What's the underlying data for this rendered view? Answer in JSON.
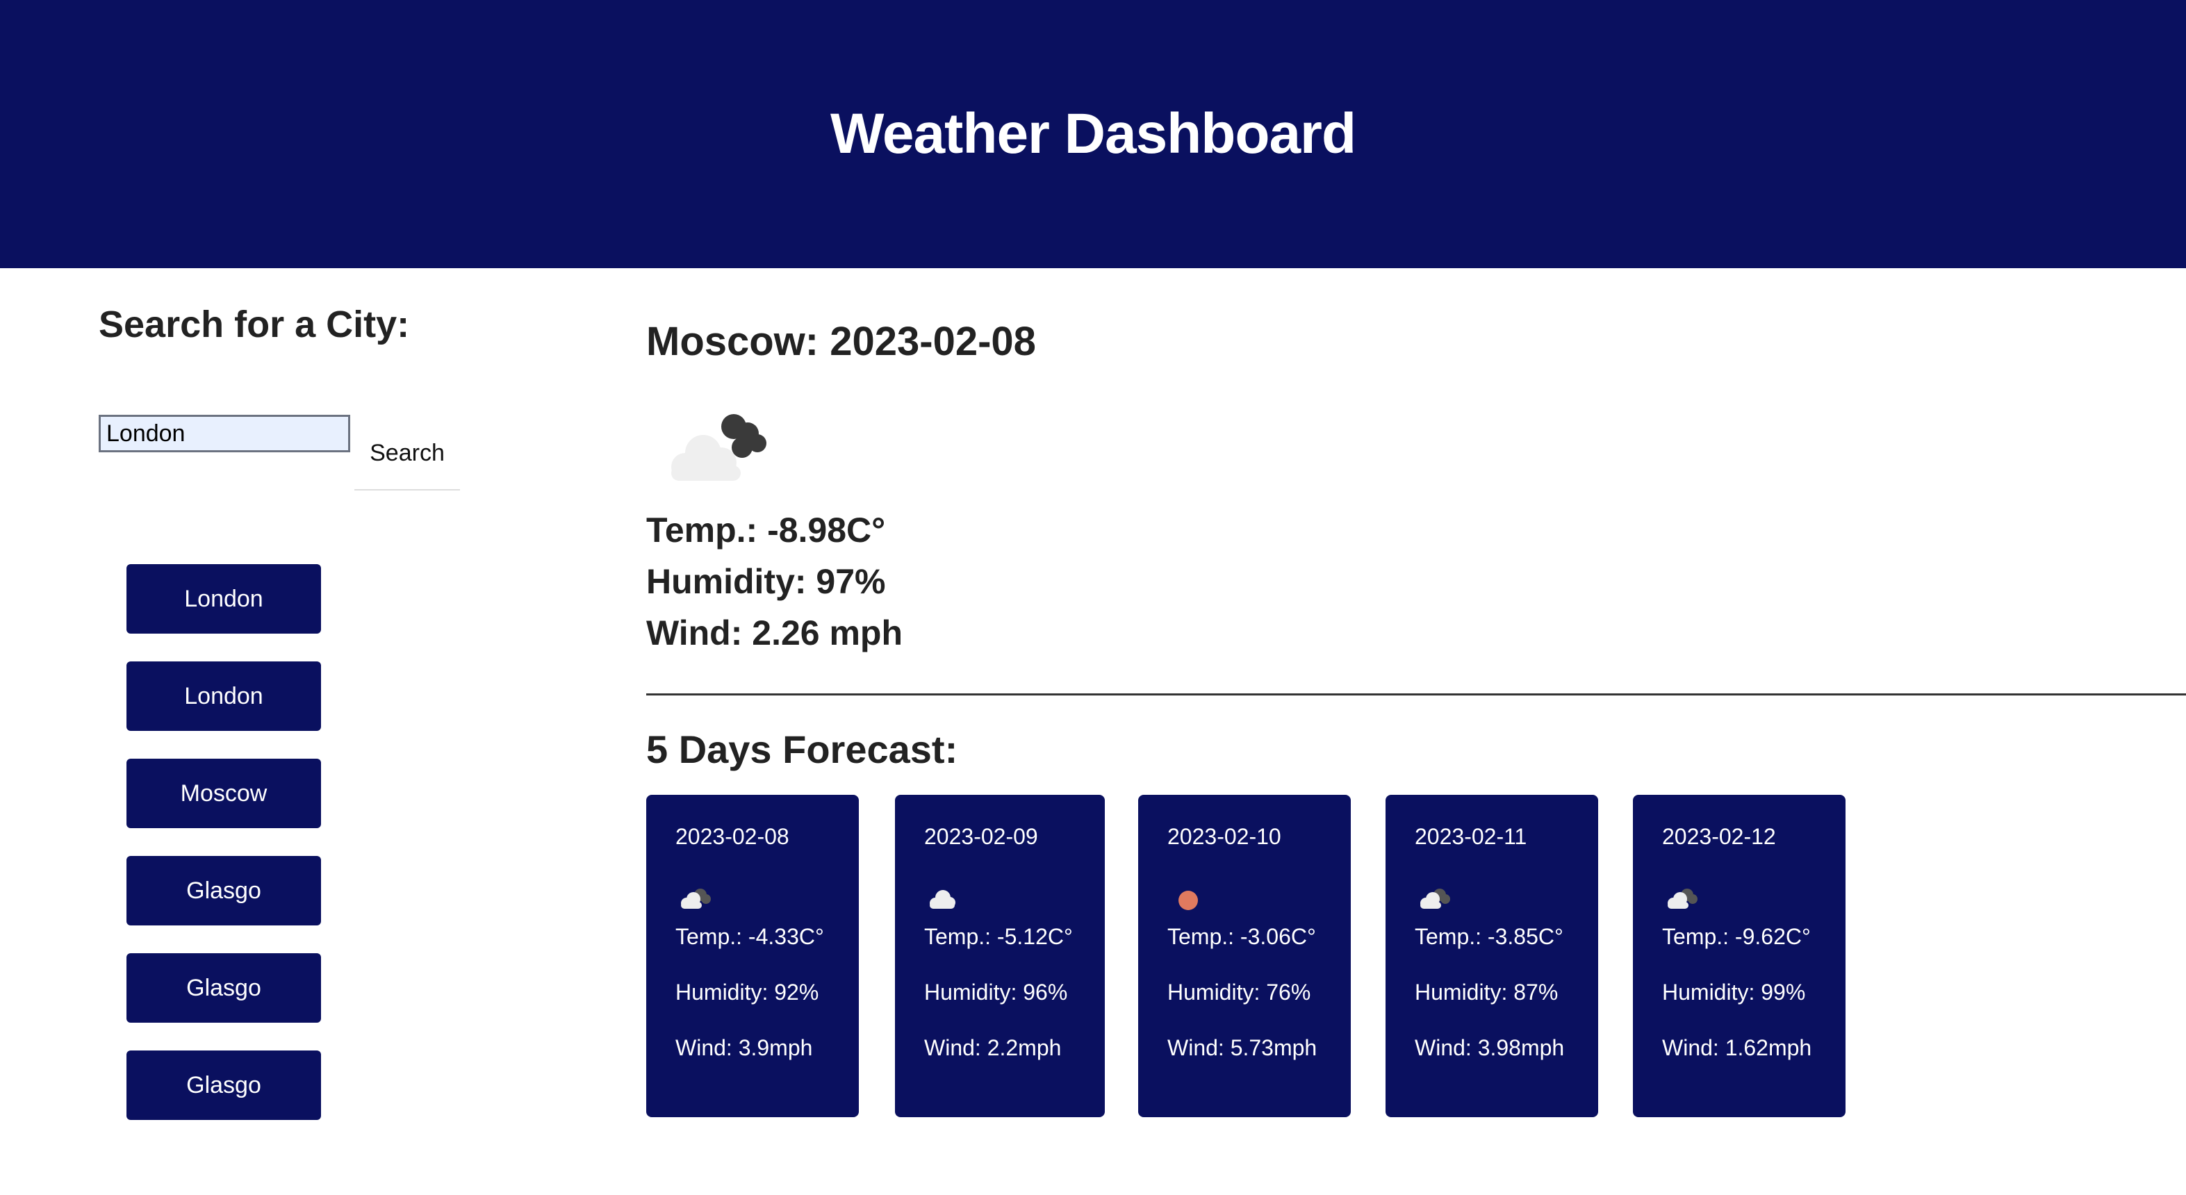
{
  "header": {
    "title": "Weather Dashboard"
  },
  "sidebar": {
    "title": "Search for a City:",
    "search": {
      "value": "London",
      "placeholder": "",
      "button_label": "Search"
    },
    "history": [
      {
        "label": "London"
      },
      {
        "label": "London"
      },
      {
        "label": "Moscow"
      },
      {
        "label": "Glasgo"
      },
      {
        "label": "Glasgo"
      },
      {
        "label": "Glasgo"
      }
    ]
  },
  "current": {
    "title": "Moscow: 2023-02-08",
    "icon": "broken-clouds-icon",
    "temp": "Temp.: -8.98C°",
    "humidity": "Humidity: 97%",
    "wind": "Wind: 2.26 mph"
  },
  "forecast": {
    "title": "5 Days Forecast:",
    "days": [
      {
        "date": "2023-02-08",
        "icon": "partly-cloudy-icon",
        "temp": "Temp.: -4.33C°",
        "humidity": "Humidity: 92%",
        "wind": "Wind: 3.9mph"
      },
      {
        "date": "2023-02-09",
        "icon": "cloud-icon",
        "temp": "Temp.: -5.12C°",
        "humidity": "Humidity: 96%",
        "wind": "Wind: 2.2mph"
      },
      {
        "date": "2023-02-10",
        "icon": "sun-icon",
        "temp": "Temp.: -3.06C°",
        "humidity": "Humidity: 76%",
        "wind": "Wind: 5.73mph"
      },
      {
        "date": "2023-02-11",
        "icon": "partly-cloudy-icon",
        "temp": "Temp.: -3.85C°",
        "humidity": "Humidity: 87%",
        "wind": "Wind: 3.98mph"
      },
      {
        "date": "2023-02-12",
        "icon": "partly-cloudy-icon",
        "temp": "Temp.: -9.62C°",
        "humidity": "Humidity: 99%",
        "wind": "Wind: 1.62mph"
      }
    ]
  },
  "colors": {
    "brand": "#0a105f",
    "text": "#222222",
    "sun": "#e07a5f"
  }
}
